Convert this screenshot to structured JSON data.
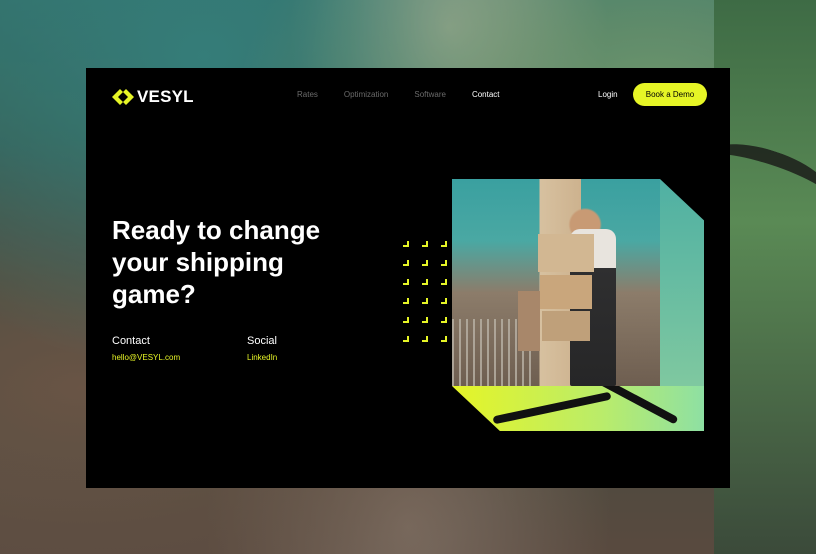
{
  "brand": {
    "name": "VESYL",
    "accent": "#e6f526"
  },
  "nav": {
    "links": [
      {
        "label": "Rates",
        "active": false
      },
      {
        "label": "Optimization",
        "active": false
      },
      {
        "label": "Software",
        "active": false
      },
      {
        "label": "Contact",
        "active": true
      }
    ],
    "login_label": "Login",
    "cta_label": "Book a Demo"
  },
  "hero": {
    "headline": "Ready to change your shipping game?"
  },
  "contact": {
    "title": "Contact",
    "email": "hello@VESYL.com"
  },
  "social": {
    "title": "Social",
    "link": "LinkedIn"
  },
  "icons": {
    "logo": "vesyl-chevron-logo-icon",
    "dots": "corner-marker-grid"
  }
}
